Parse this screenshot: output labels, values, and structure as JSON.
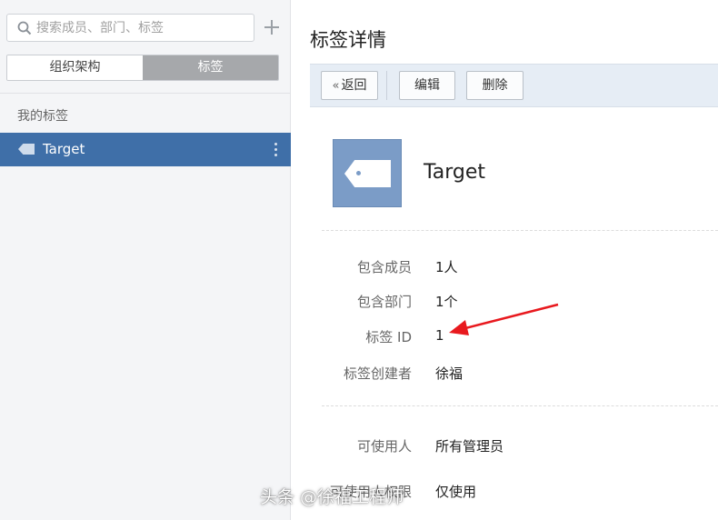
{
  "sidebar": {
    "search_placeholder": "搜索成员、部门、标签",
    "tabs": [
      {
        "label": "组织架构",
        "active": false
      },
      {
        "label": "标签",
        "active": true
      }
    ],
    "section_title": "我的标签",
    "items": [
      {
        "label": "Target",
        "selected": true
      }
    ]
  },
  "main": {
    "title": "标签详情",
    "toolbar": {
      "back_label": "返回",
      "edit_label": "编辑",
      "delete_label": "删除"
    },
    "tag_name": "Target",
    "details": [
      {
        "label": "包含成员",
        "value": "1人"
      },
      {
        "label": "包含部门",
        "value": "1个"
      },
      {
        "label": "标签 ID",
        "value": "1"
      },
      {
        "label": "标签创建者",
        "value": "徐福"
      }
    ],
    "permissions": [
      {
        "label": "可使用人",
        "value": "所有管理员"
      },
      {
        "label": "可使用人权限",
        "value": "仅使用"
      }
    ]
  },
  "watermark": "头条 @徐福工程师",
  "colors": {
    "selected_item": "#3f6fa8",
    "tag_card": "#7b9cc7",
    "toolbar_bg": "#e6edf5",
    "arrow": "#e8191e"
  }
}
